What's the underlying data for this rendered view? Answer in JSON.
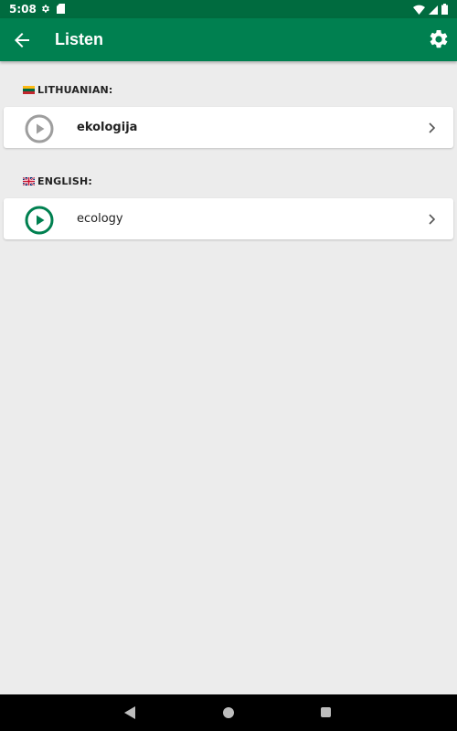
{
  "status_bar": {
    "time": "5:08"
  },
  "app_bar": {
    "title": "Listen"
  },
  "sections": [
    {
      "label": "LITHUANIAN:",
      "flag": "lithuania-flag",
      "word": "ekologija",
      "play_color": "#9e9e9e"
    },
    {
      "label": "ENGLISH:",
      "flag": "uk-flag",
      "word": "ecology",
      "play_color": "#008050"
    }
  ],
  "colors": {
    "status_bar": "#006b3f",
    "app_bar": "#008050",
    "background": "#ececec"
  }
}
